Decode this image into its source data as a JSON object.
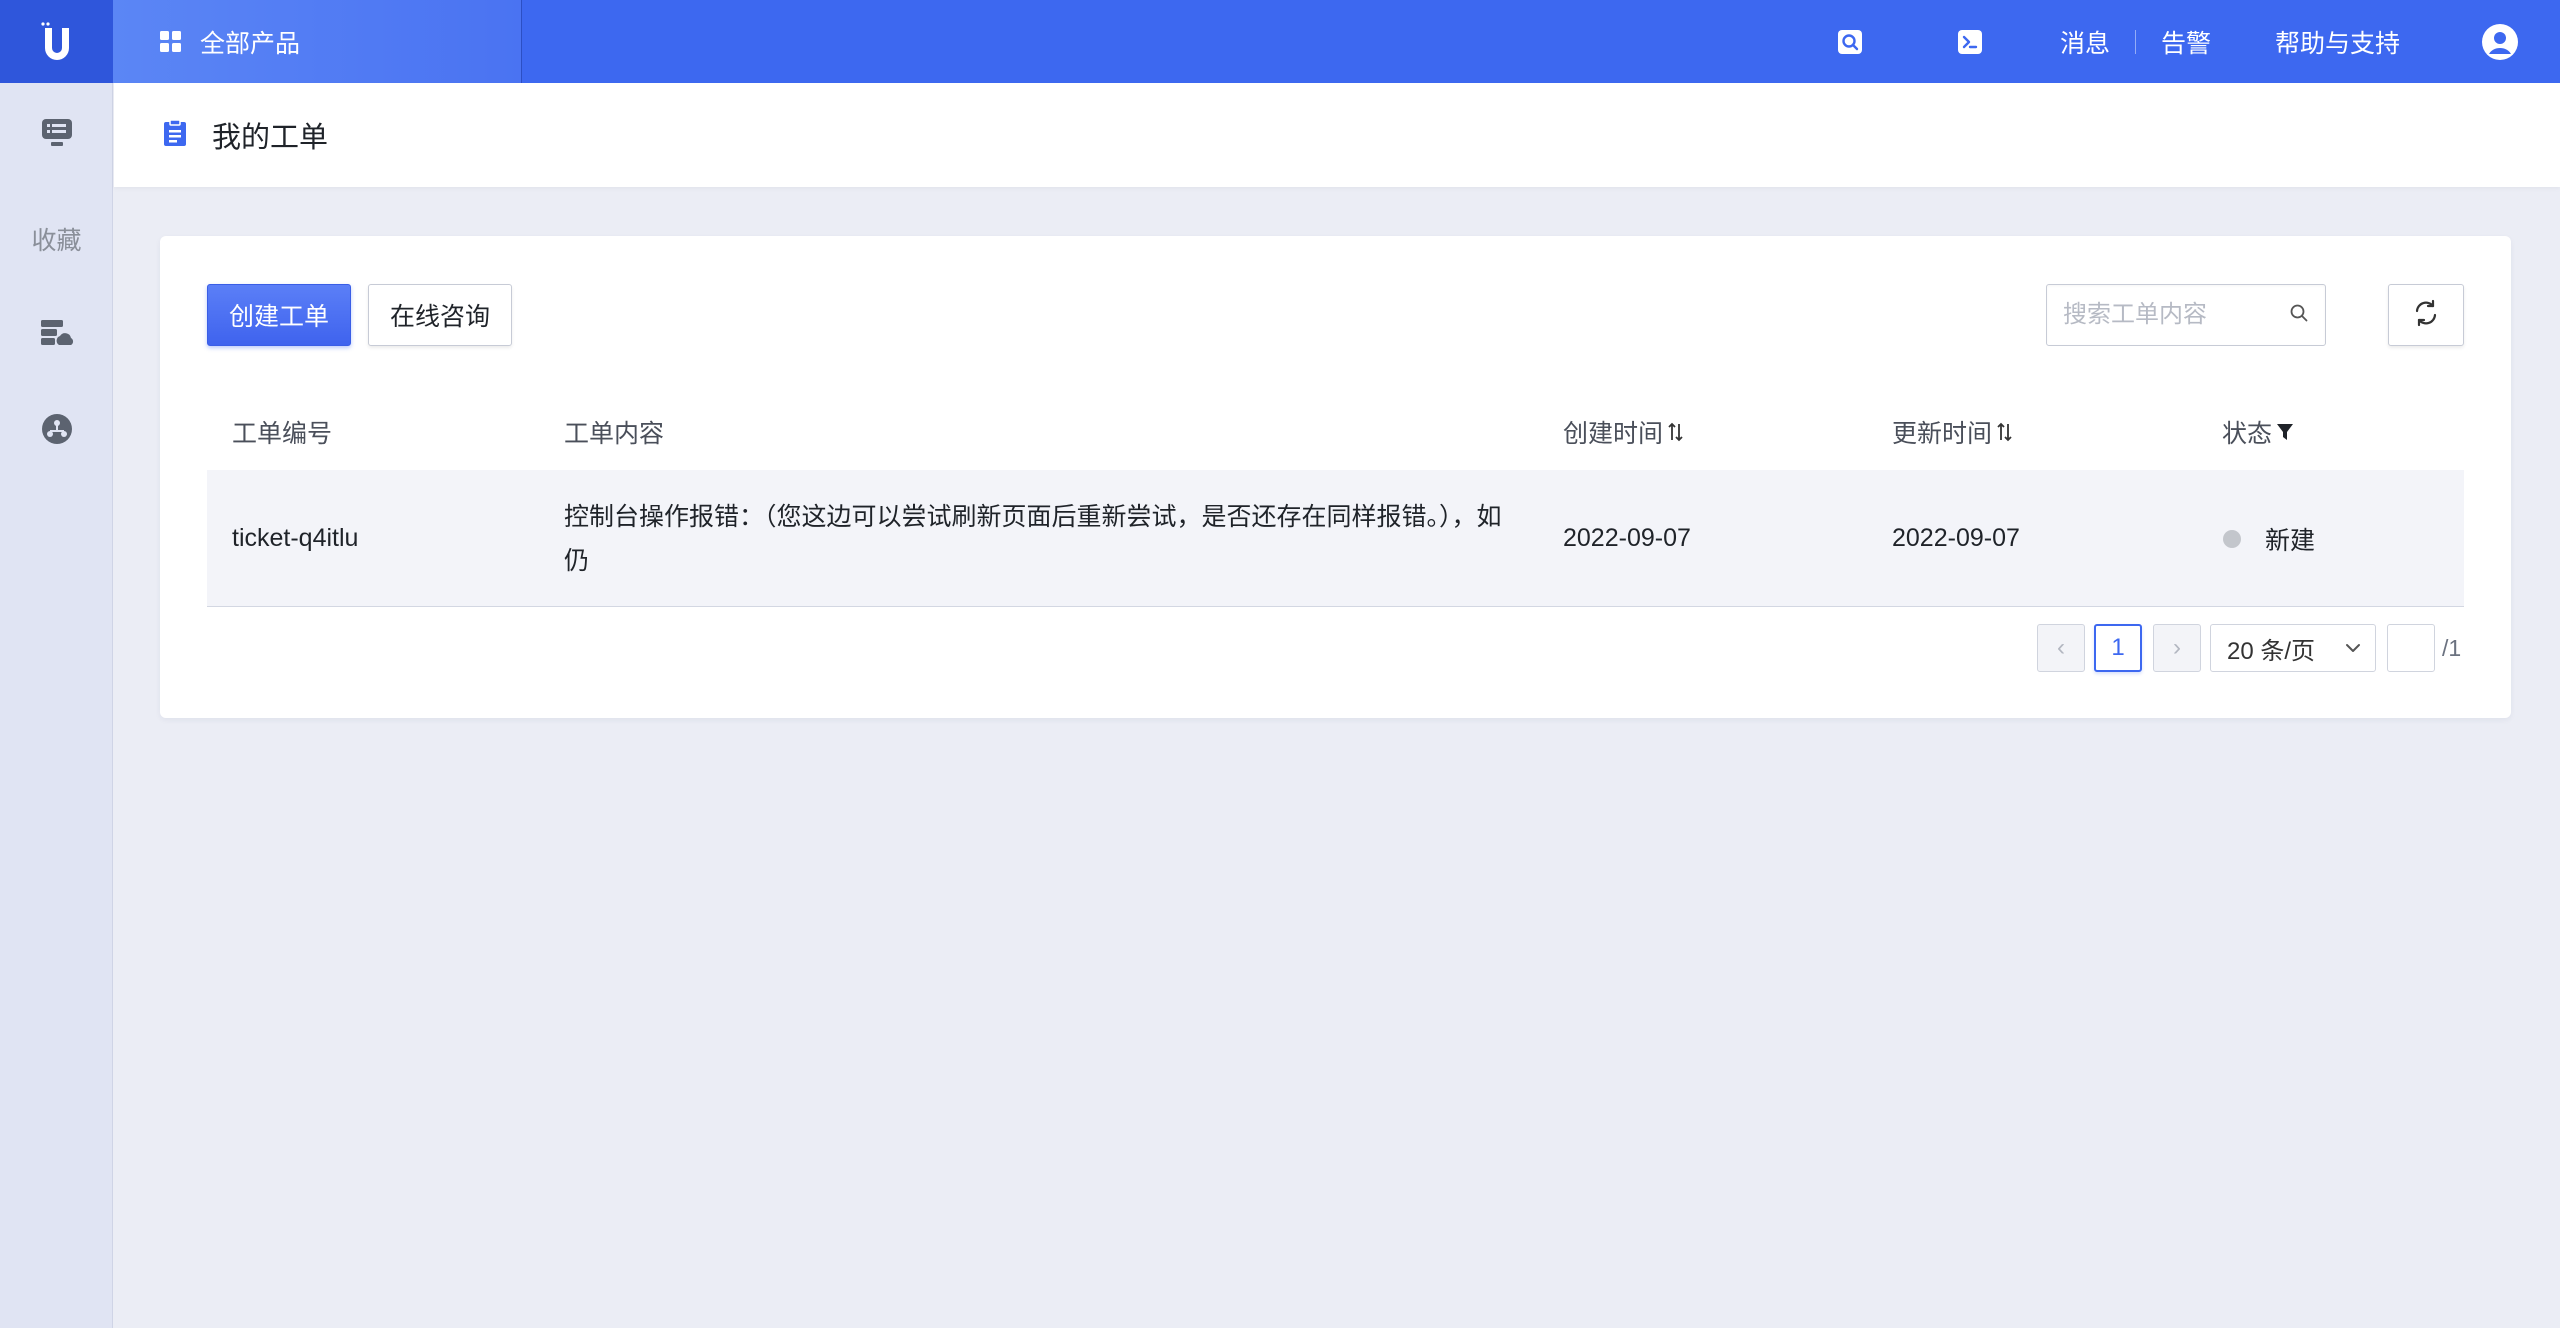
{
  "topbar": {
    "logo_letter": "U",
    "all_products_label": "全部产品",
    "messages_label": "消息",
    "alerts_label": "告警",
    "help_label": "帮助与支持",
    "colors": {
      "bar": "#3d68f0",
      "logo_bg": "#2f56db"
    }
  },
  "sidebar": {
    "favorites_label": "收藏"
  },
  "page": {
    "title": "我的工单"
  },
  "toolbar": {
    "create_ticket_label": "创建工单",
    "online_consult_label": "在线咨询",
    "search_placeholder": "搜索工单内容"
  },
  "table": {
    "columns": [
      {
        "label": "工单编号"
      },
      {
        "label": "工单内容"
      },
      {
        "label": "创建时间",
        "sortable": true
      },
      {
        "label": "更新时间",
        "sortable": true
      },
      {
        "label": "状态",
        "filterable": true
      }
    ],
    "rows": [
      {
        "id": "ticket-q4itlu",
        "content": "控制台操作报错：（您这边可以尝试刷新页面后重新尝试，是否还存在同样报错。），如仍",
        "created": "2022-09-07",
        "updated": "2022-09-07",
        "status": "新建",
        "status_color": "#c3c6cc"
      }
    ]
  },
  "pagination": {
    "prev_symbol": "‹",
    "next_symbol": "›",
    "current_page": "1",
    "page_size_label": "20 条/页",
    "jump_value": "",
    "total_pages_label": "/1"
  }
}
